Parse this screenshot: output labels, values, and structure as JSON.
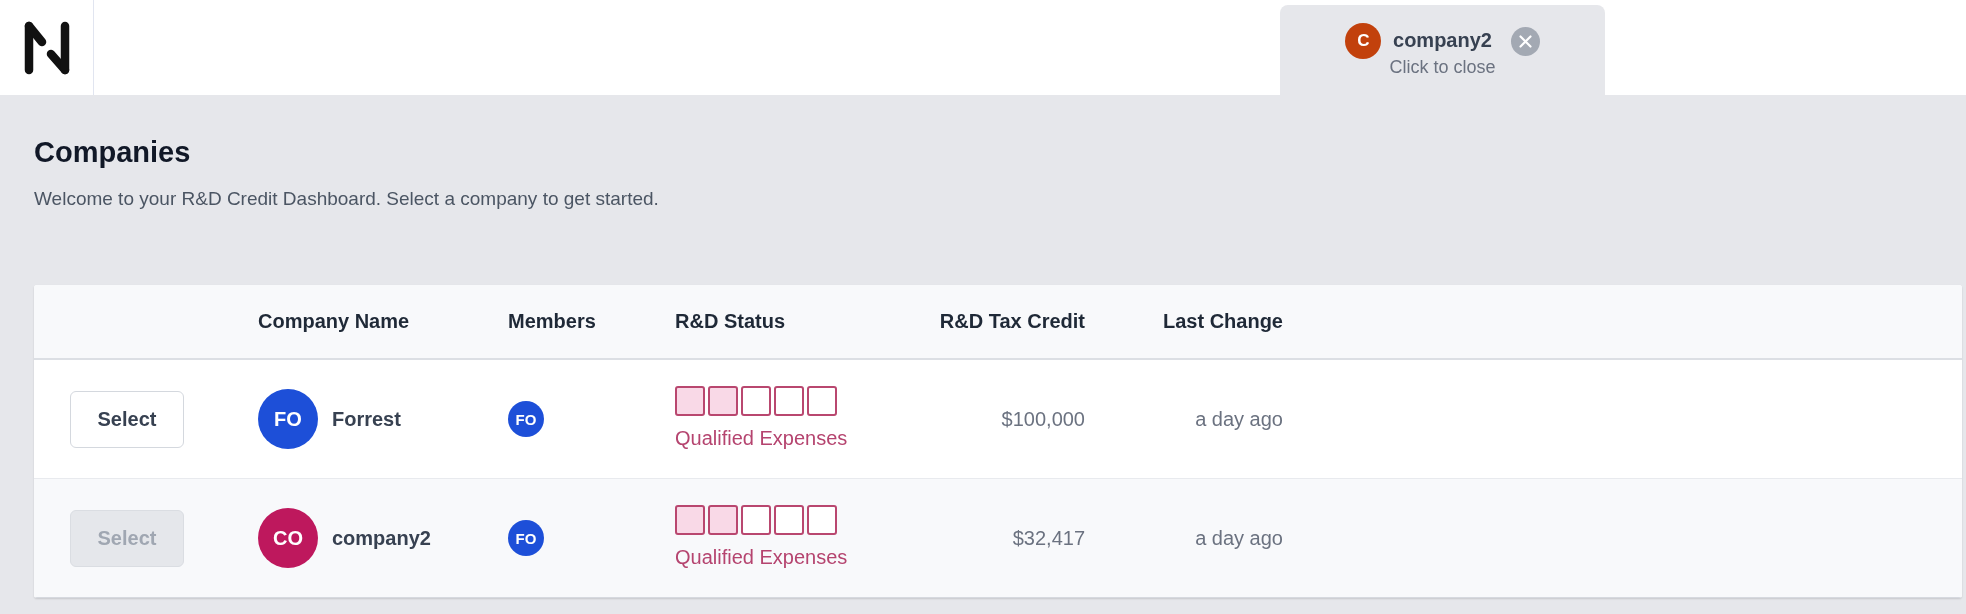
{
  "tabs": [
    {
      "avatar": "C",
      "title": "company2",
      "hint": "Click to close",
      "selected": true
    }
  ],
  "page": {
    "title": "Companies",
    "subtitle": "Welcome to your R&D Credit Dashboard. Select a company to get started."
  },
  "table": {
    "columns": [
      "Company Name",
      "Members",
      "R&D Status",
      "R&D Tax Credit",
      "Last Change"
    ],
    "rows": [
      {
        "action": {
          "label": "Select",
          "disabled": false
        },
        "company": {
          "initials": "FO",
          "name": "Forrest",
          "color": "#1d4fd8"
        },
        "members": [
          {
            "initials": "FO",
            "color": "#1d4fd8"
          }
        ],
        "status": {
          "steps": [
            {
              "done": true
            },
            {
              "done": true
            },
            {
              "done": false
            },
            {
              "done": false
            },
            {
              "done": false
            }
          ],
          "label": "Qualified Expenses"
        },
        "tax_credit": "$100,000",
        "last_change": "a day ago"
      },
      {
        "action": {
          "label": "Select",
          "disabled": true
        },
        "company": {
          "initials": "CO",
          "name": "company2",
          "color": "#be185d"
        },
        "members": [
          {
            "initials": "FO",
            "color": "#1d4fd8"
          }
        ],
        "status": {
          "steps": [
            {
              "done": true
            },
            {
              "done": true
            },
            {
              "done": false
            },
            {
              "done": false
            },
            {
              "done": false
            }
          ],
          "label": "Qualified Expenses"
        },
        "tax_credit": "$32,417",
        "last_change": "a day ago"
      }
    ]
  }
}
